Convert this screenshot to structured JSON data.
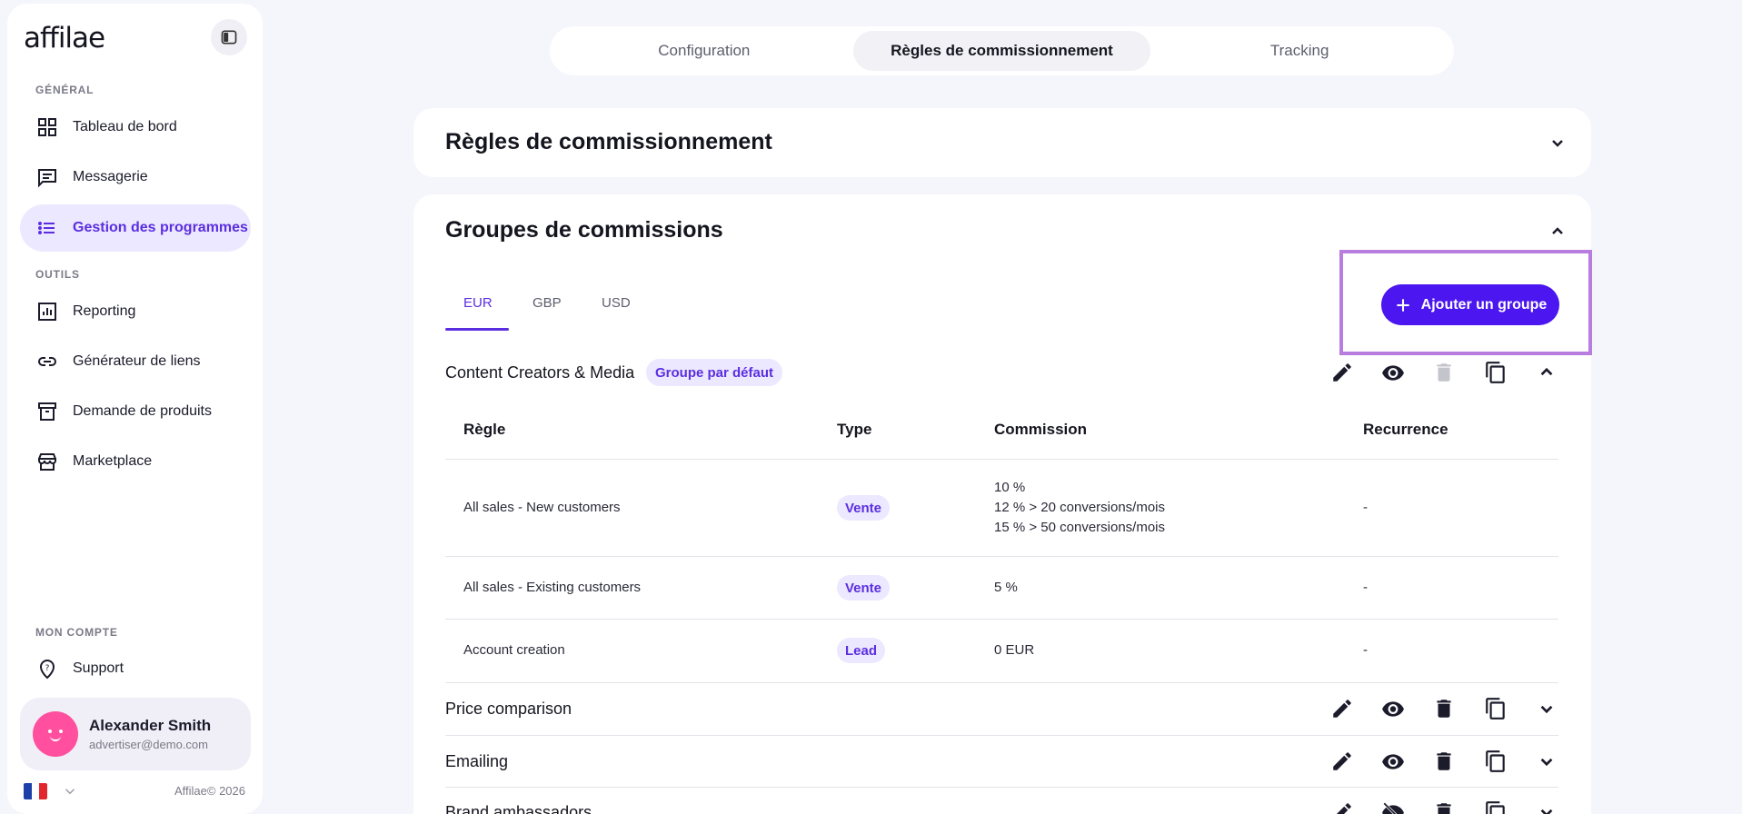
{
  "sidebar": {
    "logo": "affilae",
    "sections": {
      "general": "GÉNÉRAL",
      "tools": "OUTILS",
      "account": "MON COMPTE"
    },
    "items": [
      {
        "label": "Tableau de bord",
        "icon": "dashboard-icon"
      },
      {
        "label": "Messagerie",
        "icon": "message-icon"
      },
      {
        "label": "Gestion des programmes",
        "icon": "list-icon",
        "active": true
      },
      {
        "label": "Reporting",
        "icon": "chart-icon"
      },
      {
        "label": "Générateur de liens",
        "icon": "link-icon"
      },
      {
        "label": "Demande de produits",
        "icon": "archive-icon"
      },
      {
        "label": "Marketplace",
        "icon": "store-icon"
      },
      {
        "label": "Support",
        "icon": "help-icon"
      }
    ],
    "user": {
      "name": "Alexander Smith",
      "email": "advertiser@demo.com"
    },
    "copyright": "Affilae© 2026"
  },
  "top_tabs": [
    {
      "label": "Configuration"
    },
    {
      "label": "Règles de commissionnement",
      "active": true
    },
    {
      "label": "Tracking"
    }
  ],
  "rules_card": {
    "title": "Règles de commissionnement"
  },
  "groups_card": {
    "title": "Groupes de commissions",
    "currencies": [
      "EUR",
      "GBP",
      "USD"
    ],
    "active_currency": "EUR",
    "add_button": "Ajouter un groupe",
    "default_badge": "Groupe par défaut",
    "columns": [
      "Règle",
      "Type",
      "Commission",
      "Recurrence"
    ],
    "groups": [
      {
        "name": "Content Creators & Media",
        "expanded": true,
        "rows": [
          {
            "rule": "All sales - New customers",
            "type": "Vente",
            "commission": [
              "10 %",
              "12 % > 20 conversions/mois",
              "15 % > 50 conversions/mois"
            ],
            "recurrence": "-"
          },
          {
            "rule": "All sales - Existing customers",
            "type": "Vente",
            "commission": [
              "5 %"
            ],
            "recurrence": "-"
          },
          {
            "rule": "Account creation",
            "type": "Lead",
            "commission": [
              "0 EUR"
            ],
            "recurrence": "-"
          }
        ]
      },
      {
        "name": "Price comparison"
      },
      {
        "name": "Emailing"
      },
      {
        "name": "Brand ambassadors"
      }
    ]
  },
  "colors": {
    "accent": "#5b2ee0",
    "button": "#4b16ef",
    "highlight": "#b77ee0"
  }
}
